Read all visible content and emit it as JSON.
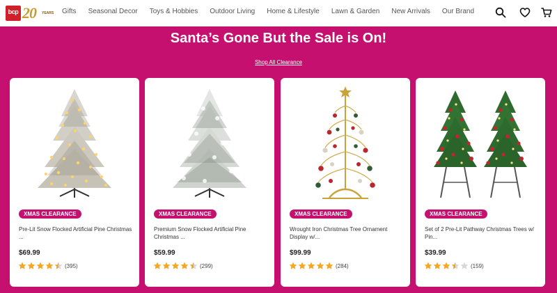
{
  "header": {
    "logo_text": "bcp",
    "logo_anniversary": "20",
    "logo_years": "YEARS",
    "nav": [
      "Gifts",
      "Seasonal Decor",
      "Toys & Hobbies",
      "Outdoor Living",
      "Home & Lifestyle",
      "Lawn & Garden",
      "New Arrivals",
      "Our Brand"
    ],
    "icons": [
      "search-icon",
      "heart-icon",
      "cart-icon"
    ]
  },
  "banner": {
    "title": "Santa’s Gone But the Sale is On!",
    "link": "Shop All Clearance"
  },
  "colors": {
    "brand": "#c5106f",
    "star": "#f5a623",
    "logo_red": "#d0202a",
    "logo_gold": "#c89b2e"
  },
  "products": [
    {
      "badge": "XMAS CLEARANCE",
      "title": "Pre-Lit Snow Flocked Artificial Pine Christmas ...",
      "price": "$69.99",
      "rating": 4.5,
      "reviews": "(395)",
      "image": "flocked-prelit-tree"
    },
    {
      "badge": "XMAS CLEARANCE",
      "title": "Premium Snow Flocked Artificial Pine Christmas ...",
      "price": "$59.99",
      "rating": 4.5,
      "reviews": "(299)",
      "image": "flocked-tree"
    },
    {
      "badge": "XMAS CLEARANCE",
      "title": "Wrought Iron Christmas Tree Ornament Display w/...",
      "price": "$99.99",
      "rating": 5,
      "reviews": "(284)",
      "image": "ornament-display-tree"
    },
    {
      "badge": "XMAS CLEARANCE",
      "title": "Set of 2 Pre-Lit Pathway Christmas Trees w/ Pin...",
      "price": "$39.99",
      "rating": 3.5,
      "reviews": "(159)",
      "image": "pathway-trees-pair"
    }
  ]
}
